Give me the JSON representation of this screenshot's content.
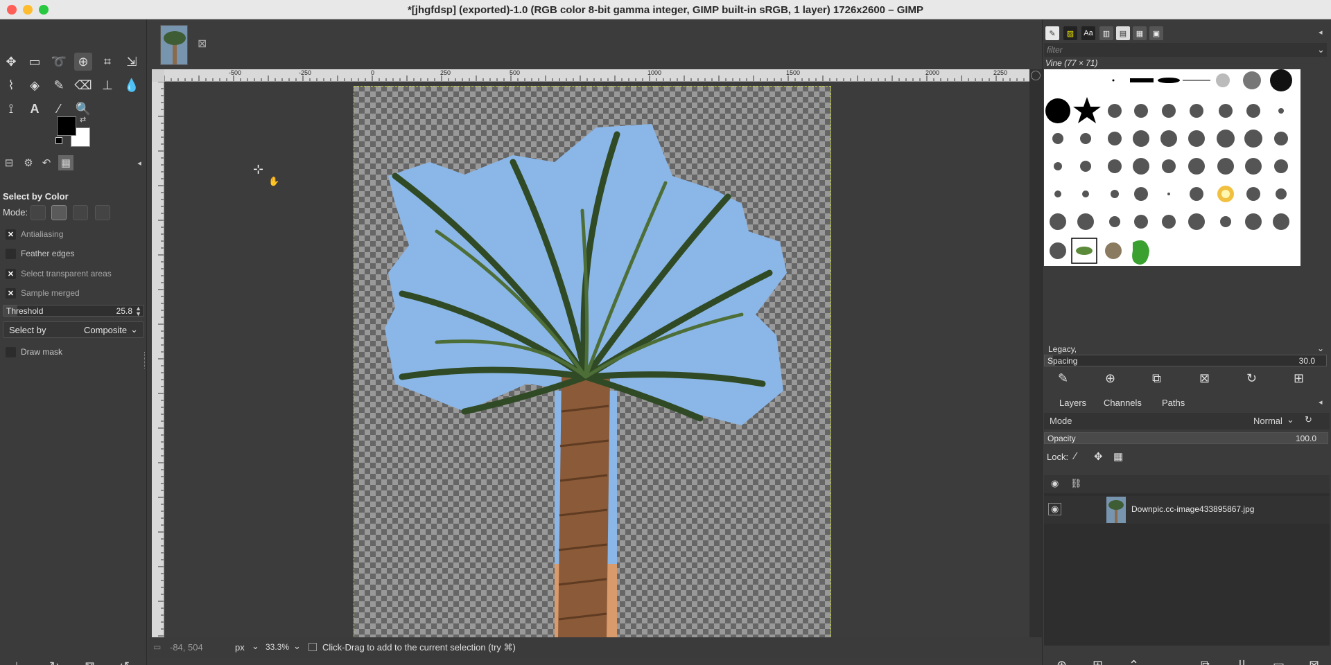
{
  "window": {
    "title": "*[jhgfdsp] (exported)-1.0 (RGB color 8-bit gamma integer, GIMP built-in sRGB, 1 layer) 1726x2600 – GIMP"
  },
  "colors": {
    "close": "#ff5f57",
    "minimize": "#febc2e",
    "maximize": "#28c840",
    "selection_tint": "#8bb7e8"
  },
  "toolbox": {
    "tools": [
      "move-icon",
      "rect-select-icon",
      "lasso-icon",
      "select-by-color-icon",
      "crop-icon",
      "transform-icon",
      "warp-icon",
      "bucket-fill-icon",
      "paintbrush-icon",
      "eraser-icon",
      "clone-icon",
      "smudge-icon",
      "paths-icon",
      "text-icon",
      "color-picker-icon",
      "zoom-icon"
    ]
  },
  "tool_options": {
    "title": "Select by Color",
    "mode_label": "Mode:",
    "antialiasing": {
      "label": "Antialiasing",
      "checked": true
    },
    "feather_edges": {
      "label": "Feather edges",
      "checked": false
    },
    "select_transparent": {
      "label": "Select transparent areas",
      "checked": true
    },
    "sample_merged": {
      "label": "Sample merged",
      "checked": true
    },
    "threshold": {
      "label": "Threshold",
      "value": "25.8",
      "fraction": 0.1
    },
    "select_by": {
      "label": "Select by",
      "value": "Composite"
    },
    "draw_mask": {
      "label": "Draw mask",
      "checked": false
    }
  },
  "rulers": {
    "h_labels": [
      "-500",
      "-250",
      "0",
      "250",
      "500",
      "1000",
      "1500",
      "2000",
      "2250"
    ]
  },
  "status": {
    "coords": "-84, 504",
    "unit": "px",
    "zoom": "33.3%",
    "message": "Click-Drag to add to the current selection (try ⌘)"
  },
  "brushes": {
    "filter_placeholder": "filter",
    "selected_name": "Vine (77 × 71)",
    "preset": "Legacy,",
    "spacing": {
      "label": "Spacing",
      "value": "30.0",
      "fraction": 0.03
    }
  },
  "layers": {
    "tabs": [
      "Layers",
      "Channels",
      "Paths"
    ],
    "mode_label": "Mode",
    "mode_value": "Normal",
    "opacity_label": "Opacity",
    "opacity_value": "100.0",
    "lock_label": "Lock:",
    "items": [
      {
        "name": "Downpic.cc-image433895867.jpg",
        "visible": true
      }
    ]
  }
}
